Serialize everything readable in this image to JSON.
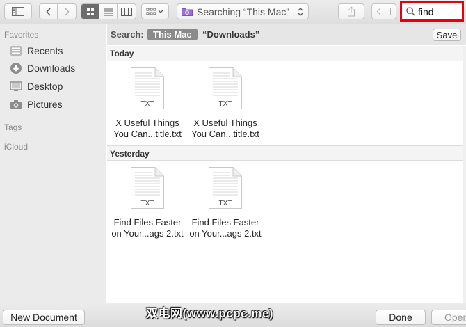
{
  "toolbar": {
    "path_text": "Searching “This Mac”",
    "search_value": "find"
  },
  "sidebar": {
    "favorites_label": "Favorites",
    "items": [
      {
        "label": "Recents",
        "icon": "clock-icon"
      },
      {
        "label": "Downloads",
        "icon": "download-icon"
      },
      {
        "label": "Desktop",
        "icon": "desktop-icon"
      },
      {
        "label": "Pictures",
        "icon": "camera-icon"
      }
    ],
    "tags_label": "Tags",
    "icloud_label": "iCloud"
  },
  "scope": {
    "label": "Search:",
    "this_mac": "This Mac",
    "downloads": "“Downloads”",
    "save": "Save"
  },
  "groups": [
    {
      "title": "Today",
      "files": [
        {
          "line1": "X Useful Things",
          "line2": "You Can...title.txt",
          "badge": "TXT"
        },
        {
          "line1": "X Useful Things",
          "line2": "You Can...title.txt",
          "badge": "TXT"
        }
      ]
    },
    {
      "title": "Yesterday",
      "files": [
        {
          "line1": "Find Files Faster",
          "line2": "on Your...ags 2.txt",
          "badge": "TXT"
        },
        {
          "line1": "Find Files Faster",
          "line2": "on Your...ags 2.txt",
          "badge": "TXT"
        }
      ]
    }
  ],
  "bottom": {
    "new_document": "New Document",
    "done": "Done",
    "open": "Open"
  },
  "watermark": "双电网(www.pcpc.me)",
  "colors": {
    "highlight_border": "#e60012",
    "active_segment": "#6d6d6d"
  }
}
